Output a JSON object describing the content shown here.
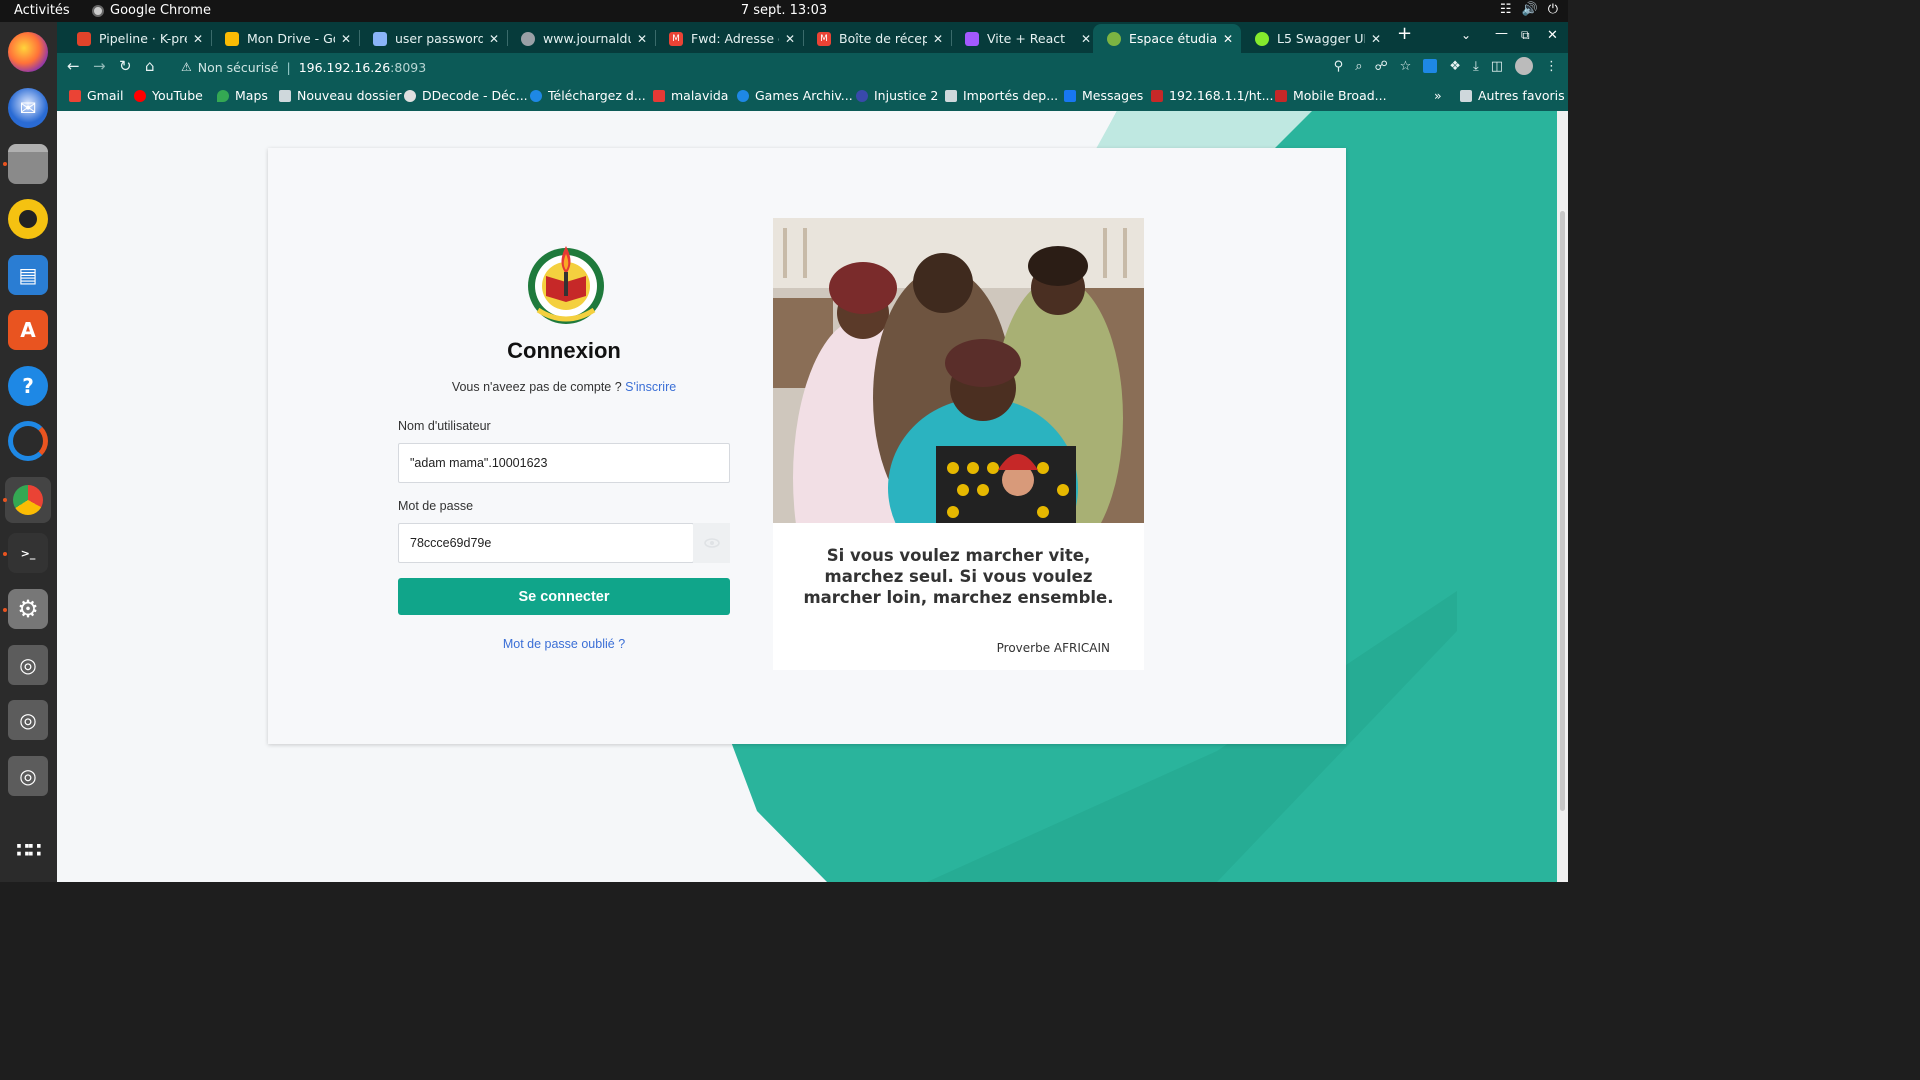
{
  "system": {
    "activities": "Activités",
    "app_name": "Google Chrome",
    "clock": "7 sept.  13:03"
  },
  "tabs": [
    {
      "label": "Pipeline · K-prein",
      "color": "#e2432a"
    },
    {
      "label": "Mon Drive - Goog",
      "color": "#fbbc04"
    },
    {
      "label": "user password_s",
      "color": "#8ab4f8"
    },
    {
      "label": "www.journaldun",
      "color": "#9aa0a6"
    },
    {
      "label": "Fwd: Adresse de",
      "color": "#ea4335"
    },
    {
      "label": "Boîte de réceptic",
      "color": "#ea4335"
    },
    {
      "label": "Vite + React",
      "color": "#a259ff"
    },
    {
      "label": "Espace étudiant",
      "color": "#7cb342"
    },
    {
      "label": "L5 Swagger UI",
      "color": "#85ea2d"
    }
  ],
  "toolbar": {
    "security_label": "Non sécurisé",
    "url_host": "196.192.16.26",
    "url_port": ":8093"
  },
  "bookmarks": [
    {
      "label": "Gmail",
      "color": "#ea4335"
    },
    {
      "label": "YouTube",
      "color": "#ff0000"
    },
    {
      "label": "Maps",
      "color": "#34a853"
    },
    {
      "label": "Nouveau dossier",
      "color": "#cfd8dc"
    },
    {
      "label": "DDecode - Déc...",
      "color": "#e0e0e0"
    },
    {
      "label": "Téléchargez d...",
      "color": "#1e88e5"
    },
    {
      "label": "malavida",
      "color": "#e53935"
    },
    {
      "label": "Games Archiv...",
      "color": "#1e88e5"
    },
    {
      "label": "Injustice 2",
      "color": "#3949ab"
    },
    {
      "label": "Importés dep...",
      "color": "#cfd8dc"
    },
    {
      "label": "Messages",
      "color": "#1877f2"
    },
    {
      "label": "192.168.1.1/ht...",
      "color": "#c62828"
    },
    {
      "label": "Mobile Broad...",
      "color": "#c62828"
    }
  ],
  "bookmarks_overflow": "»",
  "bookmarks_other": "Autres favoris",
  "login": {
    "logo_text": "UNIVERSITÉ D'ABOMEY-CALAVI",
    "title": "Connexion",
    "no_account": "Vous n'aveez pas de compte ?",
    "signup_link": "S'inscrire",
    "username_label": "Nom d'utilisateur",
    "username_value": "\"adam mama\".10001623",
    "password_label": "Mot de passe",
    "password_value": "78ccce69d79e",
    "submit_label": "Se connecter",
    "forgot_link": "Mot de passe oublié ?"
  },
  "side": {
    "quote": "Si vous voulez marcher vite, marchez seul. Si vous voulez marcher loin, marchez ensemble.",
    "proverb": "Proverbe AFRICAIN"
  },
  "colors": {
    "accent": "#10a58a",
    "teal_bg": "#1fae97",
    "link": "#3b6fd6"
  }
}
